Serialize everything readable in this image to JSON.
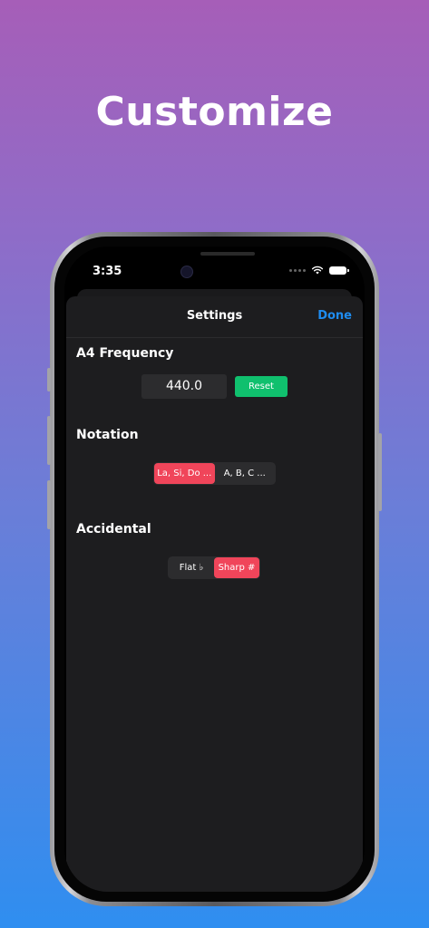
{
  "headline": "Customize",
  "status_bar": {
    "time": "3:35"
  },
  "settings": {
    "title": "Settings",
    "done_label": "Done",
    "a4_frequency": {
      "label": "A4 Frequency",
      "value": "440.0",
      "reset_label": "Reset"
    },
    "notation": {
      "label": "Notation",
      "options": [
        "La, Si, Do ...",
        "A, B, C ..."
      ],
      "selected_index": 0
    },
    "accidental": {
      "label": "Accidental",
      "options": [
        "Flat ♭",
        "Sharp #"
      ],
      "selected_index": 1
    }
  },
  "colors": {
    "accent_blue": "#1e8cf0",
    "selected_segment": "#f0455a",
    "reset_green": "#10c06e",
    "sheet_background": "#1d1d1f"
  },
  "icons": {
    "wifi": "wifi-icon",
    "battery": "battery-icon",
    "cellular": "cellular-signal-icon"
  }
}
